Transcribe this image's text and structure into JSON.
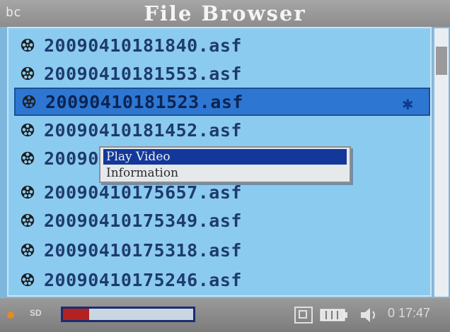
{
  "window": {
    "corner_label": "bc",
    "title": "File Browser"
  },
  "file_list": {
    "items": [
      {
        "name": "20090410181840.asf",
        "icon": "film-reel-icon"
      },
      {
        "name": "20090410181553.asf",
        "icon": "film-reel-icon"
      },
      {
        "name": "20090410181523.asf",
        "icon": "film-reel-icon",
        "selected": true,
        "mark": "✱"
      },
      {
        "name": "20090410181452.asf",
        "icon": "film-reel-icon"
      },
      {
        "name": "20090",
        "icon": "film-reel-icon"
      },
      {
        "name": "20090410175657.asf",
        "icon": "film-reel-icon"
      },
      {
        "name": "20090410175349.asf",
        "icon": "film-reel-icon"
      },
      {
        "name": "20090410175318.asf",
        "icon": "film-reel-icon"
      },
      {
        "name": "20090410175246.asf",
        "icon": "film-reel-icon"
      }
    ]
  },
  "context_menu": {
    "items": [
      "Play Video",
      "Information"
    ],
    "active_index": 0
  },
  "status_bar": {
    "storage_label": "SD",
    "progress_fraction": 0.2,
    "time": "0 17:47",
    "icons": [
      "storage-dot-icon",
      "card-icon",
      "battery-icon",
      "speaker-icon"
    ]
  },
  "colors": {
    "list_background": "#8ccbf0",
    "selection": "#2d77d3",
    "menu_highlight": "#13389a",
    "progress_fill": "#b32222"
  }
}
